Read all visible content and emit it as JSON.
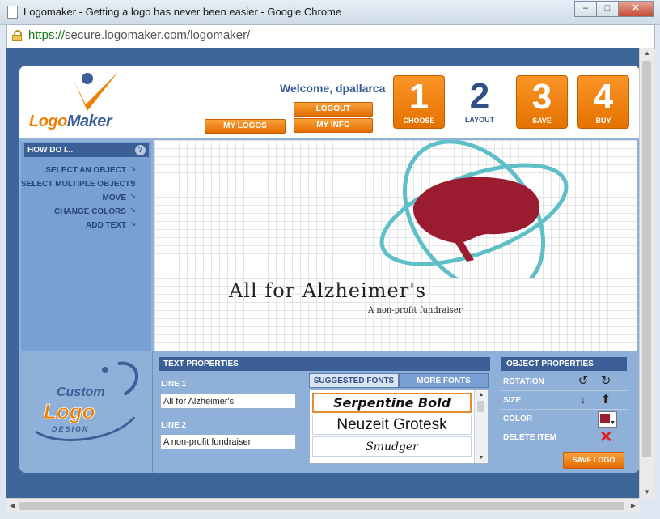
{
  "window": {
    "title": "Logomaker - Getting a logo has never been easier - Google Chrome",
    "controls": {
      "minimize": "–",
      "maximize": "□",
      "close": "✕"
    }
  },
  "addressbar": {
    "scheme": "https://",
    "host": "secure.logomaker.com",
    "path": "/logomaker/"
  },
  "header": {
    "brand": {
      "part1": "Logo",
      "part2": "Maker"
    },
    "welcome": "Welcome, dpallarca",
    "logout_label": "LOGOUT",
    "mylogos_label": "MY LOGOS",
    "myinfo_label": "MY INFO",
    "steps": [
      {
        "num": "1",
        "label": "CHOOSE"
      },
      {
        "num": "2",
        "label": "LAYOUT"
      },
      {
        "num": "3",
        "label": "SAVE"
      },
      {
        "num": "4",
        "label": "BUY"
      }
    ]
  },
  "howdo": {
    "title": "HOW DO I...",
    "help": "?",
    "items": [
      "SELECT AN OBJECT",
      "SELECT MULTIPLE OBJECTS",
      "MOVE",
      "CHANGE COLORS",
      "ADD TEXT"
    ]
  },
  "canvas": {
    "line1": "All for Alzheimer's",
    "line2": "A non-profit fundraiser",
    "colors": {
      "brain": "#9b1b30",
      "orbit": "#5fbfc9"
    }
  },
  "custom_logo": {
    "word1": "Custom",
    "word2": "Logo",
    "word3": "DESIGN"
  },
  "text_properties": {
    "title": "TEXT PROPERTIES",
    "line1_label": "LINE 1",
    "line1_value": "All for Alzheimer's",
    "line2_label": "LINE 2",
    "line2_value": "A non-profit fundraiser",
    "tabs": [
      "SUGGESTED FONTS",
      "MORE FONTS"
    ],
    "fonts": [
      "Serpentine Bold",
      "Neuzeit Grotesk",
      "Smudger"
    ]
  },
  "object_properties": {
    "title": "OBJECT PROPERTIES",
    "rotation": "ROTATION",
    "size": "SIZE",
    "color": "COLOR",
    "delete": "DELETE ITEM",
    "save_logo": "SAVE LOGO",
    "selected_color": "#9b1b30"
  }
}
